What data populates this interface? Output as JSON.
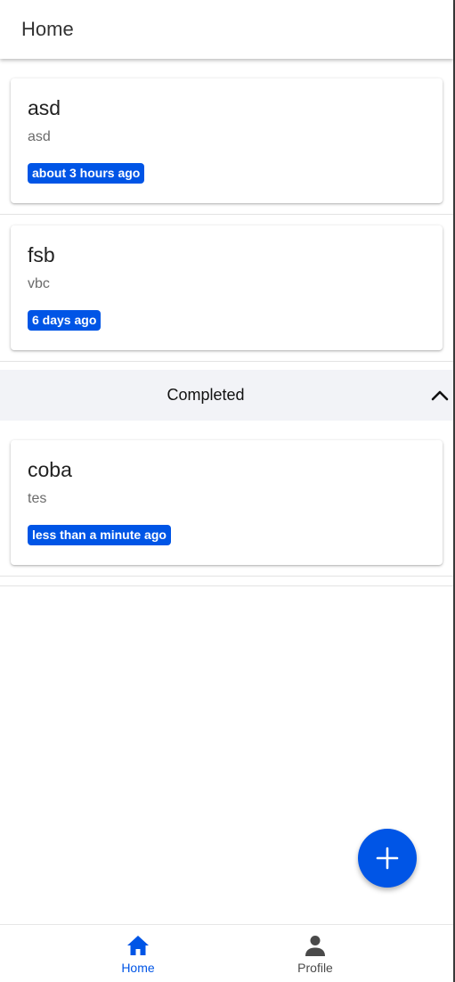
{
  "header": {
    "title": "Home"
  },
  "tasks": [
    {
      "title": "asd",
      "description": "asd",
      "time": "about 3 hours ago"
    },
    {
      "title": "fsb",
      "description": "vbc",
      "time": "6 days ago"
    }
  ],
  "completed": {
    "label": "Completed",
    "expanded": true,
    "icon": "chevron-up-icon",
    "tasks": [
      {
        "title": "coba",
        "description": "tes",
        "time": "less than a minute ago"
      }
    ]
  },
  "fab": {
    "icon": "plus-icon"
  },
  "bottom_nav": {
    "items": [
      {
        "label": "Home",
        "icon": "home-icon",
        "active": true
      },
      {
        "label": "Profile",
        "icon": "person-icon",
        "active": false
      }
    ]
  },
  "colors": {
    "accent": "#0055e6",
    "completed_bar": "#f2f3f7",
    "inactive_nav": "#4a4a4a"
  }
}
